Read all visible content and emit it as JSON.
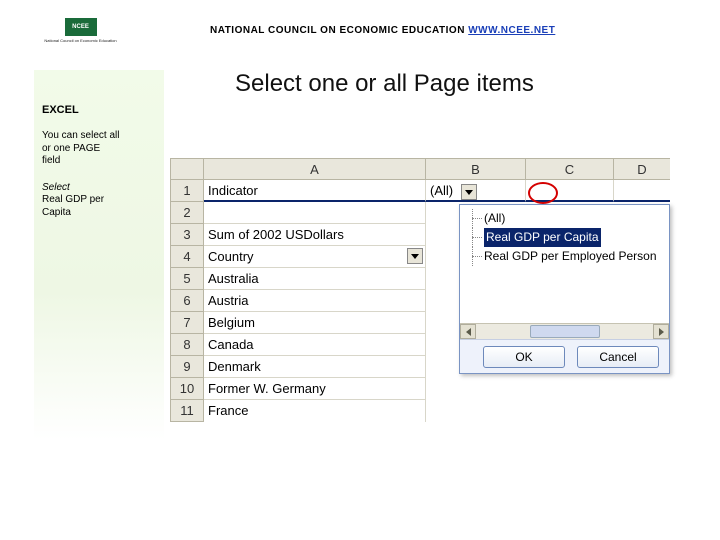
{
  "header": {
    "org_text": "NATIONAL COUNCIL ON ECONOMIC EDUCATION",
    "url_text": "WWW.NCEE.NET",
    "logo_badge": "NCEE",
    "logo_caption": "National Council on Economic Education"
  },
  "title": "Select one or all Page items",
  "sidebar": {
    "heading": "EXCEL",
    "para1_l1": "You can select all",
    "para1_l2": "or one PAGE",
    "para1_l3": "field",
    "para2_em": "Select",
    "para2_l1": "Real GDP per",
    "para2_l2": "Capita"
  },
  "spreadsheet": {
    "columns": {
      "A": "A",
      "B": "B",
      "C": "C",
      "D": "D"
    },
    "rows": [
      {
        "n": "1",
        "A": "Indicator",
        "B": "(All)"
      },
      {
        "n": "2",
        "A": ""
      },
      {
        "n": "3",
        "A": "Sum of 2002 USDollars"
      },
      {
        "n": "4",
        "A": "Country"
      },
      {
        "n": "5",
        "A": "Australia"
      },
      {
        "n": "6",
        "A": "Austria"
      },
      {
        "n": "7",
        "A": "Belgium"
      },
      {
        "n": "8",
        "A": "Canada"
      },
      {
        "n": "9",
        "A": "Denmark"
      },
      {
        "n": "10",
        "A": "Former W. Germany"
      },
      {
        "n": "11",
        "A": "France"
      }
    ]
  },
  "dropdown": {
    "items": [
      "(All)",
      "Real GDP per Capita",
      "Real GDP per Employed Person"
    ],
    "selected_index": 1,
    "buttons": {
      "ok": "OK",
      "cancel": "Cancel"
    }
  }
}
